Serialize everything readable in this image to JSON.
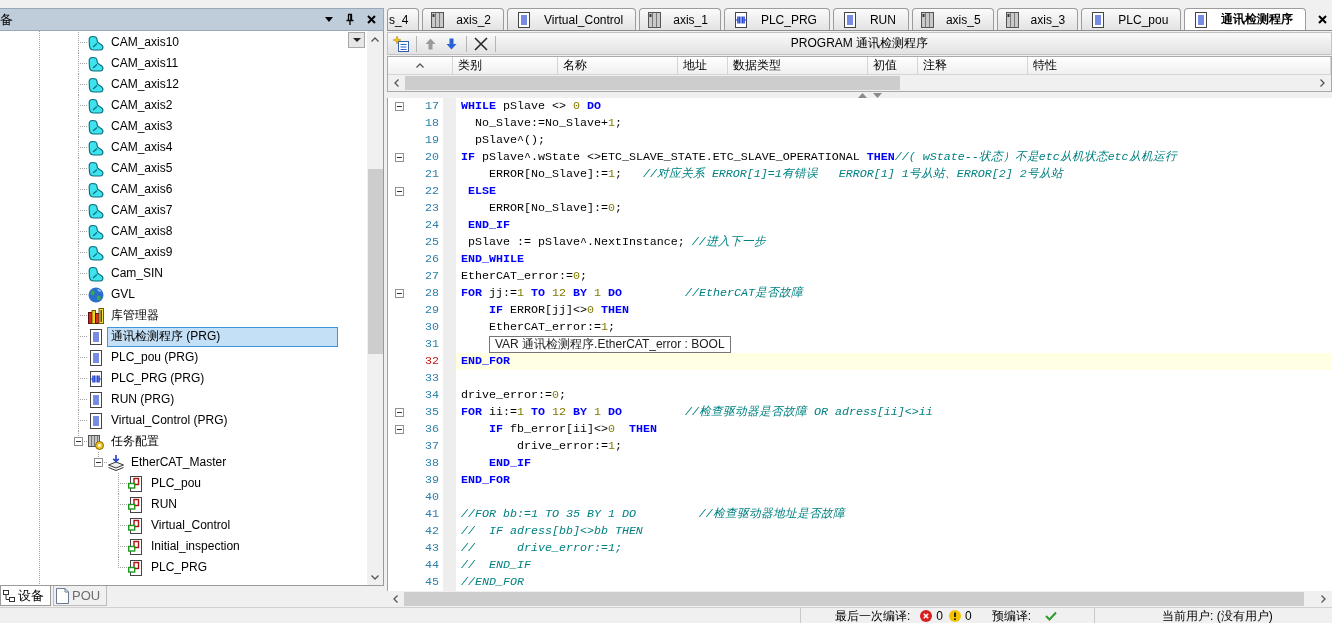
{
  "device_panel": {
    "title": "备",
    "tree": [
      {
        "kind": "cam",
        "label": "CAM_axis10",
        "selected": false
      },
      {
        "kind": "cam",
        "label": "CAM_axis11",
        "selected": false
      },
      {
        "kind": "cam",
        "label": "CAM_axis12",
        "selected": false
      },
      {
        "kind": "cam",
        "label": "CAM_axis2",
        "selected": false
      },
      {
        "kind": "cam",
        "label": "CAM_axis3",
        "selected": false
      },
      {
        "kind": "cam",
        "label": "CAM_axis4",
        "selected": false
      },
      {
        "kind": "cam",
        "label": "CAM_axis5",
        "selected": false
      },
      {
        "kind": "cam",
        "label": "CAM_axis6",
        "selected": false
      },
      {
        "kind": "cam",
        "label": "CAM_axis7",
        "selected": false
      },
      {
        "kind": "cam",
        "label": "CAM_axis8",
        "selected": false
      },
      {
        "kind": "cam",
        "label": "CAM_axis9",
        "selected": false
      },
      {
        "kind": "cam",
        "label": "Cam_SIN",
        "selected": false
      },
      {
        "kind": "gvl",
        "label": "GVL",
        "selected": false
      },
      {
        "kind": "library",
        "label": "库管理器",
        "selected": false
      },
      {
        "kind": "program",
        "label": "通讯检测程序 (PRG)",
        "selected": true
      },
      {
        "kind": "program",
        "label": "PLC_pou (PRG)",
        "selected": false
      },
      {
        "kind": "ladder",
        "label": "PLC_PRG (PRG)",
        "selected": false
      },
      {
        "kind": "program",
        "label": "RUN (PRG)",
        "selected": false
      },
      {
        "kind": "program",
        "label": "Virtual_Control (PRG)",
        "selected": false
      },
      {
        "kind": "task_config",
        "label": "任务配置",
        "selected": false,
        "expanded": true,
        "children": [
          {
            "kind": "task",
            "label": "EtherCAT_Master",
            "selected": false,
            "expanded": true,
            "children": [
              {
                "kind": "task_call",
                "label": "PLC_pou",
                "selected": false
              },
              {
                "kind": "task_call",
                "label": "RUN",
                "selected": false
              },
              {
                "kind": "task_call",
                "label": "Virtual_Control",
                "selected": false
              },
              {
                "kind": "task_call",
                "label": "Initial_inspection",
                "selected": false
              },
              {
                "kind": "task_call",
                "label": "PLC_PRG",
                "selected": false
              }
            ]
          }
        ]
      }
    ],
    "bottom_tabs": [
      {
        "kind": "devices",
        "label": "设备",
        "selected": true
      },
      {
        "kind": "pou",
        "label": "POU",
        "selected": false
      }
    ]
  },
  "editor": {
    "tabs": [
      {
        "label": "s_4",
        "selected": false
      },
      {
        "kind": "cabinet",
        "label": "axis_2",
        "selected": false
      },
      {
        "kind": "document",
        "label": "Virtual_Control",
        "selected": false
      },
      {
        "kind": "cabinet",
        "label": "axis_1",
        "selected": false
      },
      {
        "kind": "ladder",
        "label": "PLC_PRG",
        "selected": false
      },
      {
        "kind": "document",
        "label": "RUN",
        "selected": false
      },
      {
        "kind": "cabinet",
        "label": "axis_5",
        "selected": false
      },
      {
        "kind": "cabinet",
        "label": "axis_3",
        "selected": false
      },
      {
        "kind": "document",
        "label": "PLC_pou",
        "selected": false
      },
      {
        "kind": "document",
        "label": "通讯检测程序",
        "selected": true
      }
    ],
    "toolbar": {
      "buttons": [
        {
          "kind": "add",
          "disabled": false
        },
        {
          "kind": "up",
          "disabled": true
        },
        {
          "kind": "down",
          "disabled": false
        },
        {
          "kind": "delete",
          "disabled": false
        }
      ],
      "title": "PROGRAM 通讯检测程序"
    },
    "declaration_columns": [
      "类别",
      "名称",
      "地址",
      "数据类型",
      "初值",
      "注释",
      "特性"
    ],
    "code_lines": [
      {
        "number": "17",
        "fold": true,
        "current": false,
        "tokens": [
          {
            "kind": "keyword",
            "text": "WHILE"
          },
          {
            "kind": "plain",
            "text": " pSlave <> "
          },
          {
            "kind": "number",
            "text": "0"
          },
          {
            "kind": "keyword",
            "text": " DO"
          }
        ]
      },
      {
        "number": "18",
        "fold": false,
        "current": false,
        "tokens": [
          {
            "kind": "plain",
            "text": "  No_Slave:=No_Slave+"
          },
          {
            "kind": "number",
            "text": "1"
          },
          {
            "kind": "plain",
            "text": ";"
          }
        ]
      },
      {
        "number": "19",
        "fold": false,
        "current": false,
        "tokens": [
          {
            "kind": "plain",
            "text": "  pSlave^();"
          }
        ]
      },
      {
        "number": "20",
        "fold": true,
        "current": false,
        "tokens": [
          {
            "kind": "keyword",
            "text": "IF"
          },
          {
            "kind": "plain",
            "text": " pSlave^.wState <>ETC_SLAVE_STATE.ETC_SLAVE_OPERATIONAL "
          },
          {
            "kind": "keyword",
            "text": "THEN"
          },
          {
            "kind": "comment",
            "text": "//( wState--状态）不是etc从机状态etc从机运行"
          }
        ]
      },
      {
        "number": "21",
        "fold": false,
        "current": false,
        "tokens": [
          {
            "kind": "plain",
            "text": "    ERROR[No_Slave]:="
          },
          {
            "kind": "number",
            "text": "1"
          },
          {
            "kind": "plain",
            "text": ";"
          },
          {
            "kind": "comment",
            "text": "   //对应关系 ERROR[1]=1有错误   ERROR[1] 1号从站、ERROR[2] 2号从站"
          }
        ]
      },
      {
        "number": "22",
        "fold": true,
        "current": false,
        "tokens": [
          {
            "kind": "keyword",
            "text": " ELSE"
          }
        ]
      },
      {
        "number": "23",
        "fold": false,
        "current": false,
        "tokens": [
          {
            "kind": "plain",
            "text": "    ERROR[No_Slave]:="
          },
          {
            "kind": "number",
            "text": "0"
          },
          {
            "kind": "plain",
            "text": ";"
          }
        ]
      },
      {
        "number": "24",
        "fold": false,
        "current": false,
        "tokens": [
          {
            "kind": "keyword",
            "text": " END_IF"
          }
        ]
      },
      {
        "number": "25",
        "fold": false,
        "current": false,
        "tokens": [
          {
            "kind": "plain",
            "text": " pSlave := pSlave^.NextInstance; "
          },
          {
            "kind": "comment",
            "text": "//进入下一步"
          }
        ]
      },
      {
        "number": "26",
        "fold": false,
        "current": false,
        "tokens": [
          {
            "kind": "keyword",
            "text": "END_WHILE"
          }
        ]
      },
      {
        "number": "27",
        "fold": false,
        "current": false,
        "tokens": [
          {
            "kind": "plain",
            "text": "EtherCAT_error:="
          },
          {
            "kind": "number",
            "text": "0"
          },
          {
            "kind": "plain",
            "text": ";"
          }
        ]
      },
      {
        "number": "28",
        "fold": true,
        "current": false,
        "tokens": [
          {
            "kind": "keyword",
            "text": "FOR"
          },
          {
            "kind": "plain",
            "text": " jj:="
          },
          {
            "kind": "number",
            "text": "1"
          },
          {
            "kind": "keyword",
            "text": " TO"
          },
          {
            "kind": "number",
            "text": " 12"
          },
          {
            "kind": "keyword",
            "text": " BY"
          },
          {
            "kind": "number",
            "text": " 1"
          },
          {
            "kind": "keyword",
            "text": " DO"
          },
          {
            "kind": "comment",
            "text": "         //EtherCAT是否故障"
          }
        ]
      },
      {
        "number": "29",
        "fold": false,
        "current": false,
        "tokens": [
          {
            "kind": "keyword",
            "text": "    IF"
          },
          {
            "kind": "plain",
            "text": " ERROR[jj]<>"
          },
          {
            "kind": "number",
            "text": "0"
          },
          {
            "kind": "keyword",
            "text": " THEN"
          }
        ]
      },
      {
        "number": "30",
        "fold": false,
        "current": false,
        "tokens": [
          {
            "kind": "plain",
            "text": "    EtherCAT_error:="
          },
          {
            "kind": "number",
            "text": "1"
          },
          {
            "kind": "plain",
            "text": ";"
          }
        ]
      },
      {
        "number": "31",
        "fold": false,
        "current": false,
        "tooltip": "VAR 通讯检测程序.EtherCAT_error : BOOL"
      },
      {
        "number": "32",
        "fold": false,
        "current": true,
        "tokens": [
          {
            "kind": "keyword",
            "text": "END_FOR"
          }
        ]
      },
      {
        "number": "33",
        "fold": false,
        "current": false
      },
      {
        "number": "34",
        "fold": false,
        "current": false,
        "tokens": [
          {
            "kind": "plain",
            "text": "drive_error:="
          },
          {
            "kind": "number",
            "text": "0"
          },
          {
            "kind": "plain",
            "text": ";"
          }
        ]
      },
      {
        "number": "35",
        "fold": true,
        "current": false,
        "tokens": [
          {
            "kind": "keyword",
            "text": "FOR"
          },
          {
            "kind": "plain",
            "text": " ii:="
          },
          {
            "kind": "number",
            "text": "1"
          },
          {
            "kind": "keyword",
            "text": " TO"
          },
          {
            "kind": "number",
            "text": " 12"
          },
          {
            "kind": "keyword",
            "text": " BY"
          },
          {
            "kind": "number",
            "text": " 1"
          },
          {
            "kind": "keyword",
            "text": " DO"
          },
          {
            "kind": "comment",
            "text": "         //检查驱动器是否故障 OR adress[ii]<>ii"
          }
        ]
      },
      {
        "number": "36",
        "fold": true,
        "current": false,
        "tokens": [
          {
            "kind": "keyword",
            "text": "    IF"
          },
          {
            "kind": "plain",
            "text": " fb_error[ii]<>"
          },
          {
            "kind": "number",
            "text": "0"
          },
          {
            "kind": "keyword",
            "text": "  THEN"
          }
        ]
      },
      {
        "number": "37",
        "fold": false,
        "current": false,
        "tokens": [
          {
            "kind": "plain",
            "text": "        drive_error:="
          },
          {
            "kind": "number",
            "text": "1"
          },
          {
            "kind": "plain",
            "text": ";"
          }
        ]
      },
      {
        "number": "38",
        "fold": false,
        "current": false,
        "tokens": [
          {
            "kind": "keyword",
            "text": "    END_IF"
          }
        ]
      },
      {
        "number": "39",
        "fold": false,
        "current": false,
        "tokens": [
          {
            "kind": "keyword",
            "text": "END_FOR"
          }
        ]
      },
      {
        "number": "40",
        "fold": false,
        "current": false
      },
      {
        "number": "41",
        "fold": false,
        "current": false,
        "tokens": [
          {
            "kind": "comment",
            "text": "//FOR bb:=1 TO 35 BY 1 DO         //检查驱动器地址是否故障"
          }
        ]
      },
      {
        "number": "42",
        "fold": false,
        "current": false,
        "tokens": [
          {
            "kind": "comment",
            "text": "//  IF adress[bb]<>bb THEN"
          }
        ]
      },
      {
        "number": "43",
        "fold": false,
        "current": false,
        "tokens": [
          {
            "kind": "comment",
            "text": "//      drive_error:=1;"
          }
        ]
      },
      {
        "number": "44",
        "fold": false,
        "current": false,
        "tokens": [
          {
            "kind": "comment",
            "text": "//  END_IF"
          }
        ]
      },
      {
        "number": "45",
        "fold": false,
        "current": false,
        "tokens": [
          {
            "kind": "comment",
            "text": "//END_FOR"
          }
        ]
      }
    ]
  },
  "status_bar": {
    "build_label": "最后一次编译:",
    "errors": "0",
    "warnings": "0",
    "precompile_label": "预编译:",
    "precompile_ok": true,
    "user": "当前用户: (没有用户)"
  }
}
